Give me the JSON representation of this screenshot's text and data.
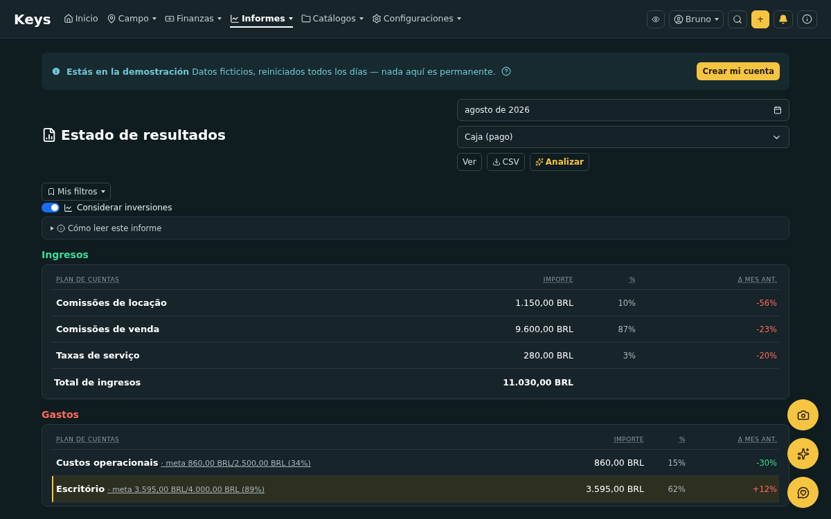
{
  "nav": {
    "logo": "Keys",
    "items": [
      {
        "label": "Inicio",
        "dropdown": false,
        "selected": false
      },
      {
        "label": "Campo",
        "dropdown": true,
        "selected": false
      },
      {
        "label": "Finanzas",
        "dropdown": true,
        "selected": false
      },
      {
        "label": "Informes",
        "dropdown": true,
        "selected": true
      },
      {
        "label": "Catálogos",
        "dropdown": true,
        "selected": false
      },
      {
        "label": "Configuraciones",
        "dropdown": true,
        "selected": false
      }
    ],
    "user": "Bruno",
    "add": "+"
  },
  "banner": {
    "title": "Estás en la demostración",
    "text": "Datos ficticios, reiniciados todos los días — nada aquí es permanente.",
    "button": "Crear mi cuenta"
  },
  "header": {
    "title": "Estado de resultados",
    "period": "agosto de 2026",
    "basis": "Caja (pago)",
    "actions": [
      {
        "label": "Ver",
        "kind": "plain"
      },
      {
        "label": "CSV",
        "kind": "download"
      },
      {
        "label": "Analizar",
        "kind": "ai"
      }
    ]
  },
  "filters": {
    "label": "Mis filtros",
    "toggle": {
      "label": "Considerar inversiones",
      "on": true
    },
    "help": "Cómo leer este informe",
    "expanded": false
  },
  "sections": [
    {
      "title": "Ingresos",
      "kind": "income",
      "columns": [
        "PLAN DE CUENTAS",
        "IMPORTE",
        "%",
        "Δ MES ANT."
      ],
      "rows": [
        {
          "name": "Comissões de locação",
          "amount": "1.150,00 BRL",
          "pct": "10%",
          "delta": "-56%",
          "good": false,
          "highlighted": false
        },
        {
          "name": "Comissões de venda",
          "amount": "9.600,00 BRL",
          "pct": "87%",
          "delta": "-23%",
          "good": false,
          "highlighted": false
        },
        {
          "name": "Taxas de serviço",
          "amount": "280,00 BRL",
          "pct": "3%",
          "delta": "-20%",
          "good": false,
          "highlighted": false
        }
      ],
      "total": {
        "name": "Total de ingresos",
        "amount": "11.030,00 BRL"
      }
    },
    {
      "title": "Gastos",
      "kind": "expense",
      "columns": [
        "PLAN DE CUENTAS",
        "IMPORTE",
        "%",
        "Δ MES ANT."
      ],
      "rows": [
        {
          "name": "Custos operacionais",
          "meta": "· meta 860,00 BRL/2.500,00 BRL (34%)",
          "amount": "860,00 BRL",
          "pct": "15%",
          "delta": "-30%",
          "good": true,
          "highlighted": false
        },
        {
          "name": "Escritório",
          "meta": "· meta 3.595,00 BRL/4.000,00 BRL (89%)",
          "amount": "3.595,00 BRL",
          "pct": "62%",
          "delta": "+12%",
          "good": false,
          "highlighted": true
        }
      ]
    }
  ]
}
